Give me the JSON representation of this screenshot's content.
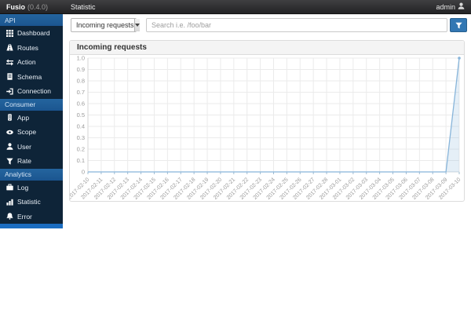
{
  "navbar": {
    "brand": "Fusio",
    "version": "(0.4.0)",
    "page_title": "Statistic",
    "user": "admin"
  },
  "sidebar": {
    "sections": [
      {
        "label": "API",
        "items": [
          {
            "label": "Dashboard",
            "icon": "dashboard-grid-icon"
          },
          {
            "label": "Routes",
            "icon": "road-icon"
          },
          {
            "label": "Action",
            "icon": "exchange-icon"
          },
          {
            "label": "Schema",
            "icon": "document-icon"
          },
          {
            "label": "Connection",
            "icon": "sign-in-icon"
          }
        ]
      },
      {
        "label": "Consumer",
        "items": [
          {
            "label": "App",
            "icon": "mobile-icon"
          },
          {
            "label": "Scope",
            "icon": "eye-icon"
          },
          {
            "label": "User",
            "icon": "user-icon"
          },
          {
            "label": "Rate",
            "icon": "filter-icon"
          }
        ]
      },
      {
        "label": "Analytics",
        "items": [
          {
            "label": "Log",
            "icon": "briefcase-icon"
          },
          {
            "label": "Statistic",
            "icon": "bar-chart-icon"
          },
          {
            "label": "Error",
            "icon": "bell-icon"
          }
        ]
      }
    ]
  },
  "toolbar": {
    "filter_select": "Incoming requests",
    "search_placeholder": "Search i.e. /foo/bar",
    "filter_button_icon": "funnel-icon"
  },
  "panel": {
    "title": "Incoming requests"
  },
  "chart_data": {
    "type": "area",
    "title": "Incoming requests",
    "x": [
      "2017-02-10",
      "2017-02-11",
      "2017-02-12",
      "2017-02-13",
      "2017-02-14",
      "2017-02-15",
      "2017-02-16",
      "2017-02-17",
      "2017-02-18",
      "2017-02-19",
      "2017-02-20",
      "2017-02-21",
      "2017-02-22",
      "2017-02-23",
      "2017-02-24",
      "2017-02-25",
      "2017-02-26",
      "2017-02-27",
      "2017-02-28",
      "2017-03-01",
      "2017-03-02",
      "2017-03-03",
      "2017-03-04",
      "2017-03-05",
      "2017-03-06",
      "2017-03-07",
      "2017-03-08",
      "2017-03-09",
      "2017-03-10"
    ],
    "series": [
      {
        "name": "Incoming requests",
        "values": [
          0,
          0,
          0,
          0,
          0,
          0,
          0,
          0,
          0,
          0,
          0,
          0,
          0,
          0,
          0,
          0,
          0,
          0,
          0,
          0,
          0,
          0,
          0,
          0,
          0,
          0,
          0,
          0,
          1.0
        ]
      }
    ],
    "ylim": [
      0,
      1.0
    ],
    "ytick_step": 0.1,
    "ytick_labels": [
      "0",
      "0.1",
      "0.2",
      "0.3",
      "0.4",
      "0.5",
      "0.6",
      "0.7",
      "0.8",
      "0.9",
      "1.0"
    ],
    "grid": true,
    "legend": "none",
    "line_color": "#88b5da",
    "fill_color": "rgba(136,181,218,0.22)",
    "grid_color": "#ebebeb",
    "tick_color": "#9fbcd2",
    "label_color": "#999999"
  },
  "colors": {
    "navbar_bg": "#2b2b2d",
    "sidebar_bg": "#0e2438",
    "section_header_bg": "#1e609f",
    "sidebar_footer_accent": "#1b6dc1",
    "filter_button_bg": "#3277b3",
    "panel_header_bg": "#f4f4f4"
  }
}
